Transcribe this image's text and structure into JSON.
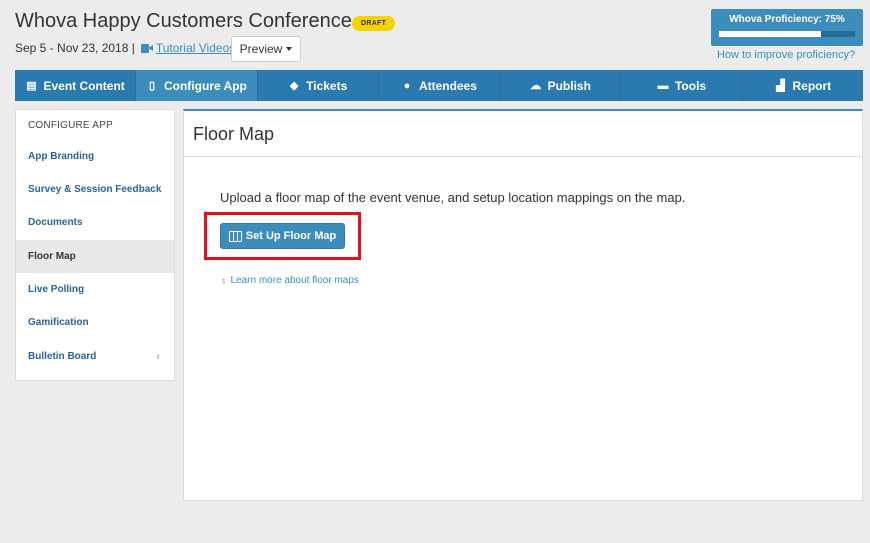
{
  "header": {
    "event_title": "Whova Happy Customers Conference",
    "draft_badge": "DRAFT",
    "date_range": "Sep 5 - Nov 23, 2018 |",
    "tutorial_link": "Tutorial Videos",
    "separator": "|",
    "preview_label": "Preview",
    "proficiency_label": "Whova Proficiency: 75%",
    "proficiency_value": 0.75,
    "proficiency_link": "How to improve proficiency?"
  },
  "nav": {
    "tabs": [
      {
        "label": "Event Content",
        "icon": "list-icon"
      },
      {
        "label": "Configure App",
        "icon": "mobile-icon"
      },
      {
        "label": "Tickets",
        "icon": "ticket-icon"
      },
      {
        "label": "Attendees",
        "icon": "users-icon"
      },
      {
        "label": "Publish",
        "icon": "cloud-upload-icon"
      },
      {
        "label": "Tools",
        "icon": "briefcase-icon"
      },
      {
        "label": "Report",
        "icon": "chart-icon"
      }
    ],
    "active_index": 1
  },
  "sidebar": {
    "heading": "CONFIGURE APP",
    "items": [
      {
        "label": "App Branding"
      },
      {
        "label": "Survey & Session Feedback"
      },
      {
        "label": "Documents"
      },
      {
        "label": "Floor Map"
      },
      {
        "label": "Live Polling"
      },
      {
        "label": "Gamification"
      },
      {
        "label": "Bulletin Board"
      }
    ],
    "active_index": 3,
    "chevron": "‹"
  },
  "main": {
    "title": "Floor Map",
    "description": "Upload a floor map of the event venue, and setup location mappings on the map.",
    "setup_button": "Set Up Floor Map",
    "learn_more": "Learn more about floor maps"
  },
  "colors": {
    "accent": "#3c8dbc",
    "nav_bg": "#2a7ab0",
    "badge": "#f6d200",
    "highlight": "#e0131b"
  }
}
